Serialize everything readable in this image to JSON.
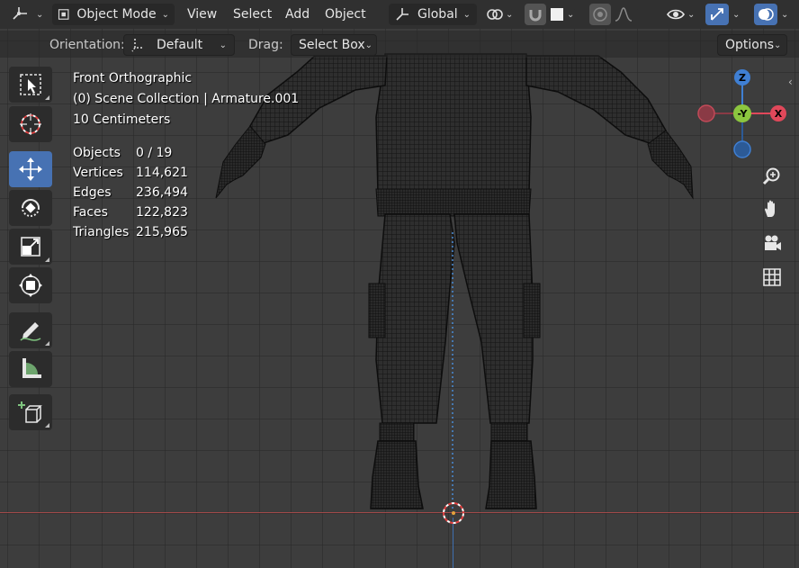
{
  "header": {
    "editor_type": "view3d-icon",
    "mode": "Object Mode",
    "menus": [
      "View",
      "Select",
      "Add",
      "Object"
    ],
    "transform_orientation": "Global"
  },
  "subheader": {
    "orientation_label": "Orientation:",
    "orientation_value": "Default",
    "drag_label": "Drag:",
    "drag_value": "Select Box",
    "options_label": "Options"
  },
  "overlay": {
    "view_name": "Front Orthographic",
    "collection": "(0) Scene Collection | Armature.001",
    "scale": "10 Centimeters",
    "stats": [
      {
        "label": "Objects",
        "value": "0 / 19"
      },
      {
        "label": "Vertices",
        "value": "114,621"
      },
      {
        "label": "Edges",
        "value": "236,494"
      },
      {
        "label": "Faces",
        "value": "122,823"
      },
      {
        "label": "Triangles",
        "value": "215,965"
      }
    ]
  },
  "gizmo": {
    "z": "Z",
    "y": "-Y",
    "x": "X"
  },
  "colors": {
    "active": "#4772b3",
    "x_axis": "#e0485a",
    "y_axis": "#8cc63f",
    "z_axis": "#3f7fd3"
  }
}
